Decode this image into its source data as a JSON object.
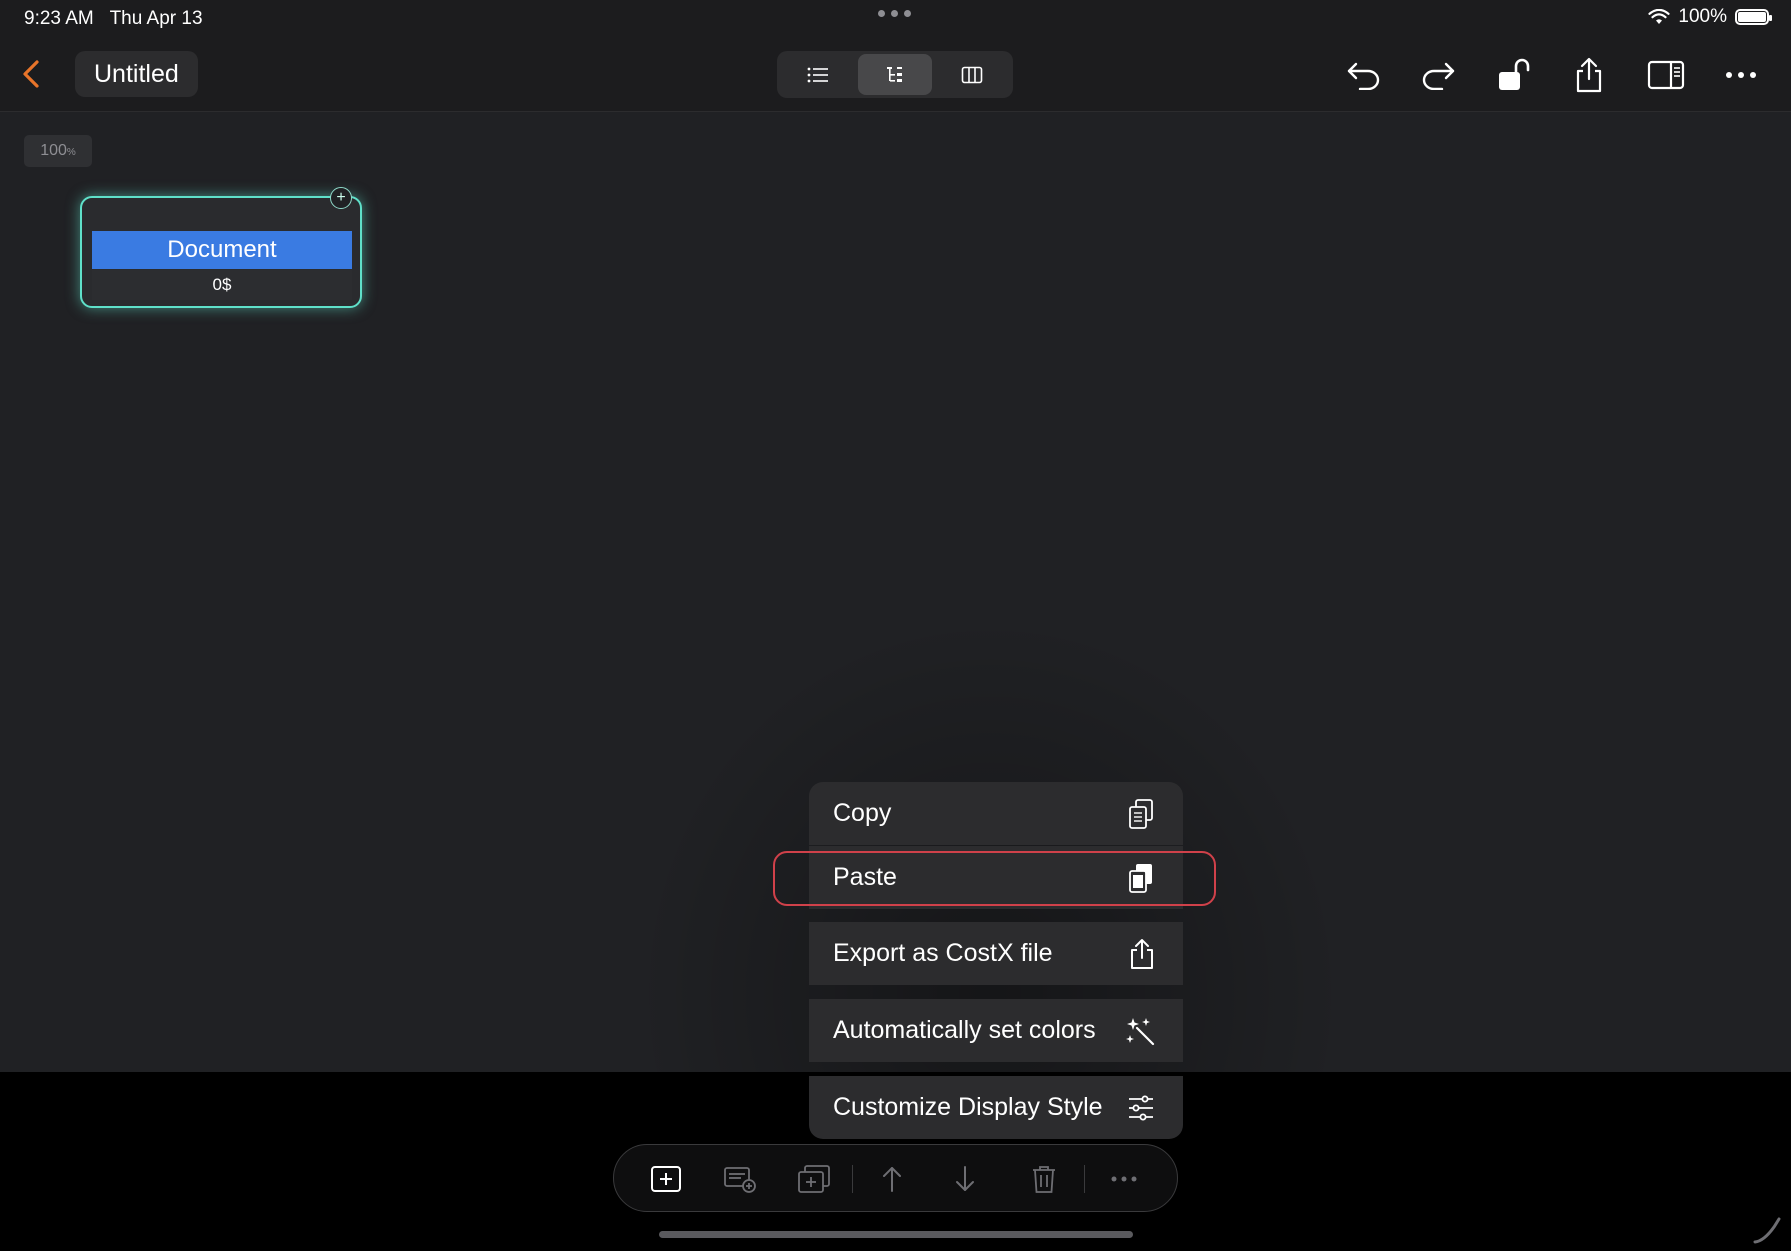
{
  "status_bar": {
    "time": "9:23 AM",
    "date": "Thu Apr 13",
    "battery_text": "100%"
  },
  "header": {
    "title": "Untitled"
  },
  "view_switcher": {
    "options": [
      "list-view-icon",
      "tree-view-icon",
      "columns-view-icon"
    ],
    "active_index": 1
  },
  "toolbar_right": [
    "undo-icon",
    "redo-icon",
    "unlock-icon",
    "share-icon",
    "sidebar-icon",
    "more-icon"
  ],
  "canvas": {
    "zoom": {
      "value": "100",
      "unit": "%"
    },
    "node": {
      "title": "Document",
      "value": "0$",
      "border_color": "#5fe0c9",
      "title_color": "#3a7be2"
    }
  },
  "context_menu": {
    "items": [
      {
        "label": "Copy",
        "icon": "copy-icon"
      },
      {
        "label": "Paste",
        "icon": "paste-icon",
        "highlighted": true
      },
      {
        "label": "Export as CostX file",
        "icon": "share-icon"
      },
      {
        "label": "Automatically set colors",
        "icon": "sparkles-icon"
      },
      {
        "label": "Customize Display Style",
        "icon": "sliders-icon"
      }
    ],
    "highlight_color": "#d0414a"
  },
  "bottom_toolbar": [
    "add-node-icon",
    "add-subnode-icon",
    "duplicate-icon",
    "arrow-up-icon",
    "arrow-down-icon",
    "trash-icon",
    "more-icon"
  ],
  "colors": {
    "accent_back": "#e8742a",
    "background": "#202124",
    "panel": "#2c2c2e"
  }
}
